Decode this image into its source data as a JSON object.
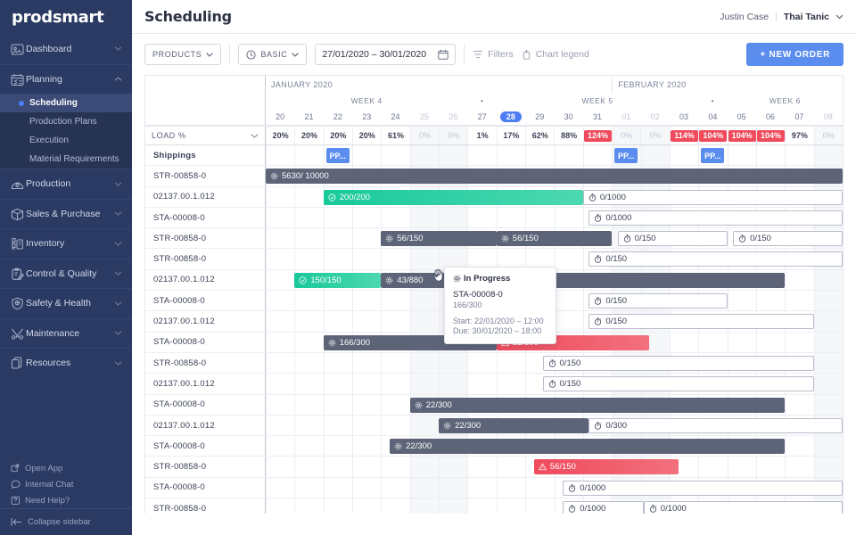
{
  "brand": "prodsmart",
  "sidebar": {
    "groups": [
      {
        "label": "Dashboard",
        "icon": "dashboard-icon",
        "open": false,
        "sub": []
      },
      {
        "label": "Planning",
        "icon": "planning-icon",
        "open": true,
        "sub": [
          "Scheduling",
          "Production Plans",
          "Execution",
          "Material Requirements"
        ],
        "active": "Scheduling"
      },
      {
        "label": "Production",
        "icon": "production-icon",
        "open": false,
        "sub": []
      },
      {
        "label": "Sales & Purchase",
        "icon": "box-icon",
        "open": false,
        "sub": []
      },
      {
        "label": "Inventory",
        "icon": "inventory-icon",
        "open": false,
        "sub": []
      },
      {
        "label": "Control & Quality",
        "icon": "clipboard-icon",
        "open": false,
        "sub": []
      },
      {
        "label": "Safety & Health",
        "icon": "shield-icon",
        "open": false,
        "sub": []
      },
      {
        "label": "Maintenance",
        "icon": "tools-icon",
        "open": false,
        "sub": []
      },
      {
        "label": "Resources",
        "icon": "folders-icon",
        "open": false,
        "sub": []
      }
    ],
    "footer": [
      {
        "label": "Open App",
        "icon": "external-link-icon"
      },
      {
        "label": "Internal Chat",
        "icon": "chat-icon"
      },
      {
        "label": "Need Help?",
        "icon": "help-icon"
      }
    ],
    "collapse": "Collapse sidebar"
  },
  "header": {
    "title": "Scheduling",
    "user": "Justin Case",
    "separator": "|",
    "org": "Thai Tanic"
  },
  "toolbar": {
    "products": "PRODUCTS",
    "view": "BASIC",
    "date_range": "27/01/2020 – 30/01/2020",
    "filters": "Filters",
    "chart_legend": "Chart legend",
    "new_order": "+ NEW ORDER"
  },
  "gantt": {
    "load_label": "LOAD %",
    "months": [
      {
        "label": "JANUARY 2020",
        "span": 12
      },
      {
        "label": "FEBRUARY 2020",
        "span": 8
      }
    ],
    "weeks": [
      {
        "label": "WEEK 4",
        "span": 7
      },
      {
        "label": "•",
        "span": 1
      },
      {
        "label": "WEEK 5",
        "span": 7
      },
      {
        "label": "•",
        "span": 1
      },
      {
        "label": "WEEK 6",
        "span": 4
      }
    ],
    "days": [
      {
        "d": "20",
        "load": "20%",
        "weekend": false,
        "today": false
      },
      {
        "d": "21",
        "load": "20%",
        "weekend": false,
        "today": false
      },
      {
        "d": "22",
        "load": "20%",
        "weekend": false,
        "today": false
      },
      {
        "d": "23",
        "load": "20%",
        "weekend": false,
        "today": false
      },
      {
        "d": "24",
        "load": "61%",
        "weekend": false,
        "today": false
      },
      {
        "d": "25",
        "load": "0%",
        "weekend": true,
        "today": false
      },
      {
        "d": "26",
        "load": "0%",
        "weekend": true,
        "today": false
      },
      {
        "d": "27",
        "load": "1%",
        "weekend": false,
        "today": false
      },
      {
        "d": "28",
        "load": "17%",
        "weekend": false,
        "today": true
      },
      {
        "d": "29",
        "load": "62%",
        "weekend": false,
        "today": false
      },
      {
        "d": "30",
        "load": "88%",
        "weekend": false,
        "today": false
      },
      {
        "d": "31",
        "load": "124%",
        "weekend": false,
        "today": false,
        "over": true
      },
      {
        "d": "01",
        "load": "0%",
        "weekend": true,
        "today": false
      },
      {
        "d": "02",
        "load": "0%",
        "weekend": true,
        "today": false
      },
      {
        "d": "03",
        "load": "114%",
        "weekend": false,
        "today": false,
        "over": true
      },
      {
        "d": "04",
        "load": "104%",
        "weekend": false,
        "today": false,
        "over": true
      },
      {
        "d": "05",
        "load": "104%",
        "weekend": false,
        "today": false,
        "over": true
      },
      {
        "d": "06",
        "load": "104%",
        "weekend": false,
        "today": false,
        "over": true
      },
      {
        "d": "07",
        "load": "97%",
        "weekend": false,
        "today": false
      },
      {
        "d": "08",
        "load": "0%",
        "weekend": true,
        "today": false
      }
    ],
    "rows": [
      {
        "label": "Shippings",
        "head": true,
        "shippings": [
          {
            "col": 2,
            "text": "PP..."
          },
          {
            "col": 12,
            "text": "PP..."
          },
          {
            "col": 15,
            "text": "PP..."
          }
        ],
        "bars": []
      },
      {
        "label": "STR-00858-0",
        "bars": [
          {
            "start": 0,
            "end": 20,
            "text": "5630/ 10000",
            "kind": "grey",
            "icon": "gear-icon"
          }
        ]
      },
      {
        "label": "02137.00.1.012",
        "bars": [
          {
            "start": 2,
            "end": 11,
            "text": "200/200",
            "kind": "green",
            "icon": "check-icon"
          },
          {
            "start": 11,
            "end": 20,
            "text": "0/1000",
            "kind": "plain",
            "icon": "timer-icon"
          }
        ]
      },
      {
        "label": "STA-00008-0",
        "bars": [
          {
            "start": 11.2,
            "end": 20,
            "text": "0/1000",
            "kind": "plain",
            "icon": "timer-icon"
          }
        ]
      },
      {
        "label": "STR-00858-0",
        "bars": [
          {
            "start": 4,
            "end": 8,
            "text": "56/150",
            "kind": "grey",
            "icon": "gear-icon"
          },
          {
            "start": 8,
            "end": 12,
            "text": "56/150",
            "kind": "grey",
            "icon": "gear-icon"
          },
          {
            "start": 12.2,
            "end": 16,
            "text": "0/150",
            "kind": "plain",
            "icon": "timer-icon"
          },
          {
            "start": 16.2,
            "end": 20,
            "text": "0/150",
            "kind": "plain",
            "icon": "timer-icon"
          }
        ]
      },
      {
        "label": "STR-00858-0",
        "bars": [
          {
            "start": 11.2,
            "end": 20,
            "text": "0/150",
            "kind": "plain",
            "icon": "timer-icon"
          }
        ]
      },
      {
        "label": "02137.00.1.012",
        "bars": [
          {
            "start": 1,
            "end": 4,
            "text": "150/150",
            "kind": "green",
            "icon": "check-icon"
          },
          {
            "start": 4,
            "end": 18,
            "text": "43/880",
            "kind": "grey",
            "icon": "gear-icon"
          }
        ]
      },
      {
        "label": "STA-00008-0",
        "bars": [
          {
            "start": 11.2,
            "end": 16,
            "text": "0/150",
            "kind": "plain",
            "icon": "timer-icon"
          }
        ]
      },
      {
        "label": "02137.00.1.012",
        "bars": [
          {
            "start": 11.2,
            "end": 19,
            "text": "0/150",
            "kind": "plain",
            "icon": "timer-icon"
          }
        ]
      },
      {
        "label": "STA-00008-0",
        "bars": [
          {
            "start": 2,
            "end": 8,
            "text": "166/300",
            "kind": "grey",
            "icon": "gear-icon"
          },
          {
            "start": 8,
            "end": 13.3,
            "text": "22/300",
            "kind": "red",
            "icon": "warning-icon"
          }
        ]
      },
      {
        "label": "STR-00858-0",
        "bars": [
          {
            "start": 9.6,
            "end": 19,
            "text": "0/150",
            "kind": "plain",
            "icon": "timer-icon"
          }
        ]
      },
      {
        "label": "02137.00.1.012",
        "bars": [
          {
            "start": 9.6,
            "end": 19,
            "text": "0/150",
            "kind": "plain",
            "icon": "timer-icon"
          }
        ]
      },
      {
        "label": "STA-00008-0",
        "bars": [
          {
            "start": 5,
            "end": 18,
            "text": "22/300",
            "kind": "grey",
            "icon": "gear-icon"
          }
        ]
      },
      {
        "label": "02137.00.1.012",
        "bars": [
          {
            "start": 6,
            "end": 11.2,
            "text": "22/300",
            "kind": "grey",
            "icon": "gear-icon"
          },
          {
            "start": 11.2,
            "end": 20,
            "text": "0/300",
            "kind": "plain",
            "icon": "timer-icon"
          }
        ]
      },
      {
        "label": "STA-00008-0",
        "bars": [
          {
            "start": 4.3,
            "end": 18,
            "text": "22/300",
            "kind": "grey",
            "icon": "gear-icon"
          }
        ]
      },
      {
        "label": "STR-00858-0",
        "bars": [
          {
            "start": 9.3,
            "end": 14.3,
            "text": "56/150",
            "kind": "red",
            "icon": "warning-icon"
          }
        ]
      },
      {
        "label": "STA-00008-0",
        "bars": [
          {
            "start": 10.3,
            "end": 20,
            "text": "0/1000",
            "kind": "plain",
            "icon": "timer-icon"
          }
        ]
      },
      {
        "label": "STR-00858-0",
        "bars": [
          {
            "start": 10.3,
            "end": 13.1,
            "text": "0/1000",
            "kind": "plain",
            "icon": "timer-icon"
          },
          {
            "start": 13.1,
            "end": 20,
            "text": "0/1000",
            "kind": "plain",
            "icon": "timer-icon"
          }
        ]
      }
    ],
    "tooltip": {
      "status": "In Progress",
      "code": "STA-00008-0",
      "qty": "166/300",
      "start": "Start: 22/01/2020 – 12:00",
      "due": "Due: 30/01/2020 – 18:00"
    }
  }
}
